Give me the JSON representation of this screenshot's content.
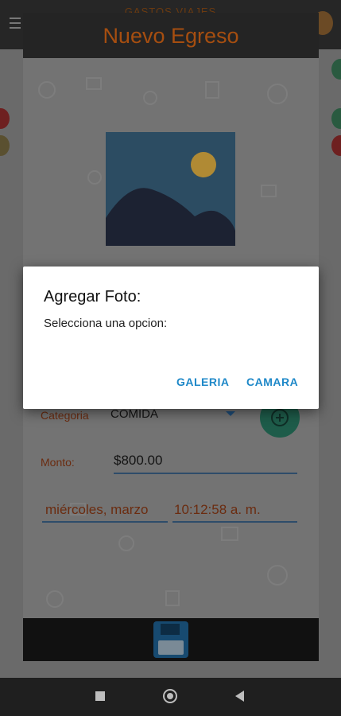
{
  "app": {
    "title": "GASTOS VIAJES"
  },
  "card": {
    "title": "Nuevo Egreso",
    "category_label": "Categoria",
    "category_value": "COMIDA",
    "amount_label": "Monto:",
    "amount_value": "$800.00",
    "date_value": "miércoles, marzo",
    "time_value": "10:12:58 a. m."
  },
  "dialog": {
    "title": "Agregar Foto:",
    "message": "Selecciona una opcion:",
    "buttons": {
      "gallery": "GALERIA",
      "camera": "CAMARA"
    }
  },
  "colors": {
    "accent": "#e0741c",
    "dialog_button": "#1e88c8",
    "field_underline": "#2e4c6a"
  },
  "icons": [
    "menu-icon",
    "avatar",
    "image-placeholder-icon",
    "add-icon",
    "dropdown-arrow-icon",
    "save-icon",
    "nav-recents-icon",
    "nav-home-icon",
    "nav-back-icon"
  ]
}
